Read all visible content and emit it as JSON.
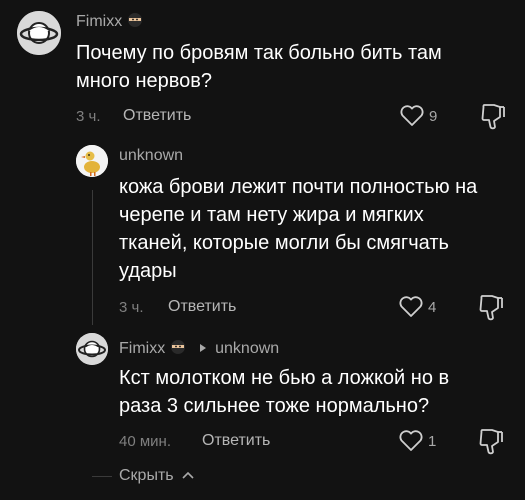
{
  "comments": [
    {
      "username": "Fimixx",
      "text_lines": [
        "Почему по бровям так больно бить там",
        "много нервов?"
      ],
      "time": "3 ч.",
      "reply_label": "Ответить",
      "likes": "9"
    },
    {
      "username": "unknown",
      "text_lines": [
        "кожа брови лежит почти полностью на",
        "черепе и там нету жира и мягких",
        "тканей, которые могли бы смягчать",
        "удары"
      ],
      "time": "3 ч.",
      "reply_label": "Ответить",
      "likes": "4"
    },
    {
      "username": "Fimixx",
      "reply_to": "unknown",
      "text_lines": [
        "Кст молотком не бью а ложкой но в",
        "раза 3 сильнее тоже нормально?"
      ],
      "time": "40 мин.",
      "reply_label": "Ответить",
      "likes": "1"
    }
  ],
  "hide_label": "Скрыть",
  "icons": {
    "like": "heart-outline-icon",
    "dislike": "thumbs-down-icon",
    "reply_arrow": "triangle-right-icon",
    "hide_chevron": "chevron-up-icon",
    "username_emoji": "ninja-emoji-icon",
    "avatar_1": "saturn-planet-avatar",
    "avatar_2": "duck-avatar"
  },
  "colors": {
    "background": "#121212",
    "text": "#ffffff",
    "muted": "#a9a9a9"
  }
}
